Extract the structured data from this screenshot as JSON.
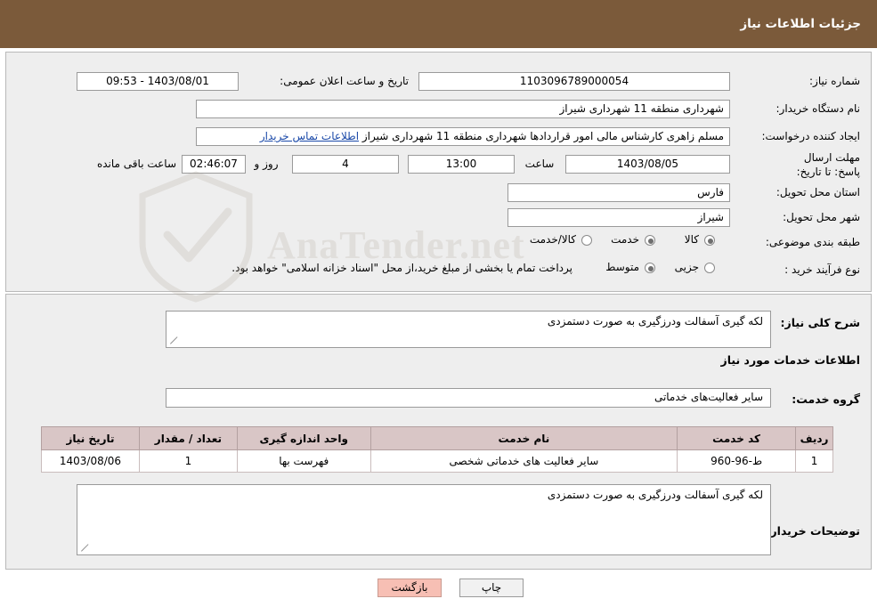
{
  "header": {
    "title": "جزئیات اطلاعات نیاز"
  },
  "form": {
    "need_number": {
      "label": "شماره نیاز:",
      "value": "1103096789000054"
    },
    "buyer_org": {
      "label": "نام دستگاه خریدار:",
      "value": "شهرداری منطقه 11 شهرداری شیراز"
    },
    "requester": {
      "label": "ایجاد کننده درخواست:",
      "value": "مسلم زاهری کارشناس مالی امور قراردادها شهرداری منطقه 11 شهرداری شیراز",
      "link": "اطلاعات تماس خریدار"
    },
    "announce_datetime": {
      "label": "تاریخ و ساعت اعلان عمومی:",
      "value": "1403/08/01 - 09:53"
    },
    "deadline": {
      "label": "مهلت ارسال پاسخ: تا تاریخ:",
      "date": "1403/08/05",
      "hour_label": "ساعت",
      "hour": "13:00",
      "days": "4",
      "days_label": "روز و",
      "remaining": "02:46:07",
      "remaining_label": "ساعت باقی مانده"
    },
    "province": {
      "label": "استان محل تحویل:",
      "value": "فارس"
    },
    "city": {
      "label": "شهر محل تحویل:",
      "value": "شیراز"
    },
    "category": {
      "label": "طبقه بندی موضوعی:",
      "options": [
        "کالا",
        "خدمت",
        "کالا/خدمت"
      ],
      "selected": "خدمت"
    },
    "purchase_type": {
      "label": "نوع فرآیند خرید :",
      "options": [
        "جزیی",
        "متوسط"
      ],
      "selected": "جزیی",
      "note": "پرداخت تمام یا بخشی از مبلغ خرید،از محل \"اسناد خزانه اسلامی\" خواهد بود."
    }
  },
  "watermark": {
    "text": "AnaTender.net"
  },
  "details": {
    "general_desc_label": "شرح کلی نیاز:",
    "general_desc_value": "لکه گیری آسفالت ودرزگیری به صورت دستمزدی",
    "services_heading": "اطلاعات خدمات مورد نیاز",
    "service_group_label": "گروه خدمت:",
    "service_group_value": "سایر فعالیت‌های خدماتی",
    "buyer_notes_label": "توضیحات خریدار:",
    "buyer_notes_value": "لکه گیری آسفالت ودرزگیری به صورت دستمزدی"
  },
  "table": {
    "columns": [
      "ردیف",
      "کد خدمت",
      "نام خدمت",
      "واحد اندازه گیری",
      "تعداد / مقدار",
      "تاریخ نیاز"
    ],
    "rows": [
      {
        "row": "1",
        "code": "ط-96-960",
        "name": "سایر فعالیت های خدماتی شخصی",
        "unit": "فهرست بها",
        "qty": "1",
        "date": "1403/08/06"
      }
    ]
  },
  "footer": {
    "print_label": "چاپ",
    "back_label": "بازگشت"
  }
}
